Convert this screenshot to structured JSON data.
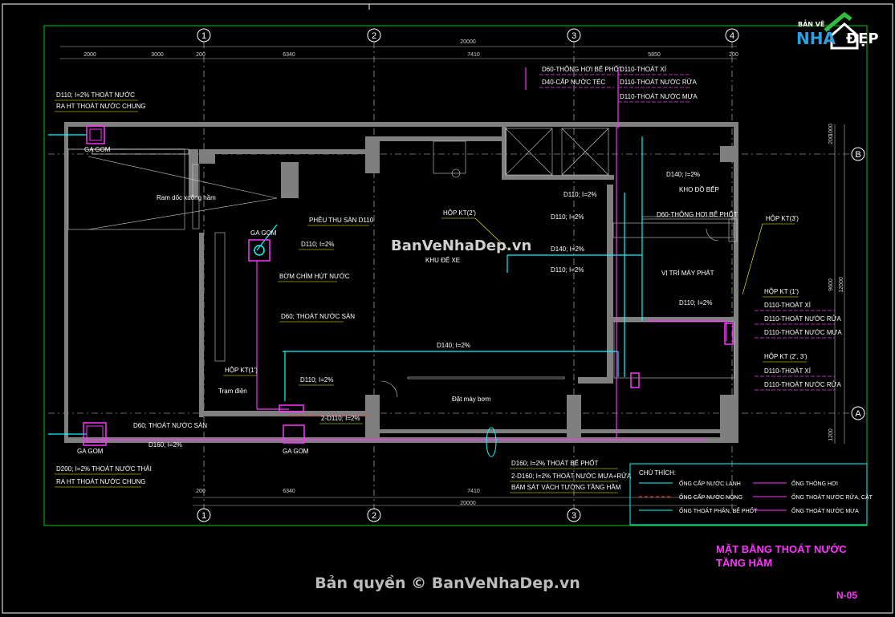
{
  "grid": {
    "cols": [
      "1",
      "2",
      "3",
      "4"
    ],
    "rows": [
      "B",
      "A"
    ]
  },
  "dims": {
    "top_overall": "20000",
    "top_segments": [
      "2000",
      "3000",
      "200",
      "6340",
      "7410",
      "5850",
      "200"
    ],
    "bottom_overall": "20000",
    "bottom_segments": [
      "200",
      "6340",
      "7410"
    ],
    "right_segments": [
      "200",
      "1000",
      "9600",
      "1200"
    ],
    "right_overall": "12000"
  },
  "labels": {
    "top_left_1": "D110; I=2% THOÁT NƯỚC",
    "top_left_2": "RA HT THOÁT NƯỚC CHUNG",
    "top_c1": "D60-THÔNG HƠI BỂ PHỐT",
    "top_c2": "D40-CẤP NƯỚC TÉC",
    "top_r1": "D110-THOÁT XÍ",
    "top_r2": "D110-THOÁT NƯỚC RỬA",
    "top_r3": "D110-THOÁT NƯỚC MƯA",
    "ga_gom": "GA GOM",
    "ram_doc": "Ram dốc xuống hầm",
    "pheu_thu": "PHỄU THU SÀN D110",
    "d110_a": "D110; I=2%",
    "bom_chim": "BƠM CHÌM HÚT NƯỚC",
    "hop_kt_2": "HỘP KT(2')",
    "khu_de_xe": "KHU ĐỂ XE",
    "d140_a": "D140; I=2%",
    "d110_b": "D110; I=2%",
    "d110_c": "D110; I=2%",
    "d110_d": "D110; I=2%",
    "d140_b": "D140; I=2%",
    "kho_do_bep": "KHO ĐỒ BẾP",
    "d60_thong_hoi": "D60-THÔNG HƠI BỂ PHỐT",
    "hop_kt_3": "HỘP KT(3')",
    "vi_tri_may_phat": "VỊ TRÍ MÁY PHÁT",
    "d110_e": "D110; I=2%",
    "d60_thoat_san": "D60; THOÁT NƯỚC SÀN",
    "d140_main": "D140; I=2%",
    "hop_kt_1": "HỘP KT(1')",
    "d110_f": "D110; I=2%",
    "tram_dien": "Trạm điện",
    "dat_may_bom": "Đặt máy bơm",
    "two_d110": "2-D110; I=2%",
    "d60_thoat_nuoc_san": "D60; THOÁT NƯỚC SÀN",
    "d160": "D160; I=2%",
    "d200_1": "D200; I=2% THOÁT NƯỚC THẢI",
    "d200_2": "RA HT THOÁT NƯỚC CHUNG",
    "hopkt1_t": "HỘP KT (1')",
    "hopkt1_a": "D110-THOÁT XÍ",
    "hopkt1_b": "D110-THOÁT NƯỚC RỬA",
    "hopkt1_c": "D110-THOÁT NƯỚC MƯA",
    "hopkt23_t": "HỘP KT (2', 3')",
    "hopkt23_a": "D110-THOÁT XÍ",
    "hopkt23_b": "D110-THOÁT NƯỚC RỬA",
    "bot_1": "D160; I=2% THOÁT BỂ PHỐT",
    "bot_2": "2-D160; I=2% THOÁT NƯỚC MƯA+RỬA",
    "bot_3": "BÁM SÁT VÁCH TƯỜNG TẦNG HẦM"
  },
  "legend": {
    "title": "CHÚ THÍCH:",
    "items": [
      {
        "label": "ỐNG CẤP NƯỚC LẠNH",
        "color": "#00ffff",
        "style": "solid"
      },
      {
        "label": "ỐNG THÔNG HƠI",
        "color": "#ff33ff",
        "style": "marked"
      },
      {
        "label": "ỐNG CẤP NƯỚC NÓNG",
        "color": "#ff3333",
        "style": "dashed"
      },
      {
        "label": "ỐNG THOÁT NƯỚC RỬA, CẶT",
        "color": "#ff33ff",
        "style": "marked"
      },
      {
        "label": "ỐNG THOÁT PHÂN, BỂ PHỐT",
        "color": "#00ffff",
        "style": "arrow"
      },
      {
        "label": "ỐNG THOÁT NƯỚC MƯA",
        "color": "#ff33ff",
        "style": "marked"
      }
    ]
  },
  "title": {
    "line1": "MẶT BẰNG THOÁT NƯỚC",
    "line2": "TẦNG HẦM"
  },
  "sheet": "N-05",
  "copyright": "Bản quyền © BanVeNhaDep.vn",
  "watermark": "BanVeNhaDep.vn",
  "logo": {
    "small": "BẢN VẼ",
    "big": "NHÀ",
    "end": "ĐẸP"
  },
  "colors": {
    "wall": "#8c8c8c",
    "pipe_cyan": "#00ffff",
    "pipe_magenta": "#ff33ff",
    "label_yellow": "#ffff00",
    "border_green": "#00cc00"
  }
}
